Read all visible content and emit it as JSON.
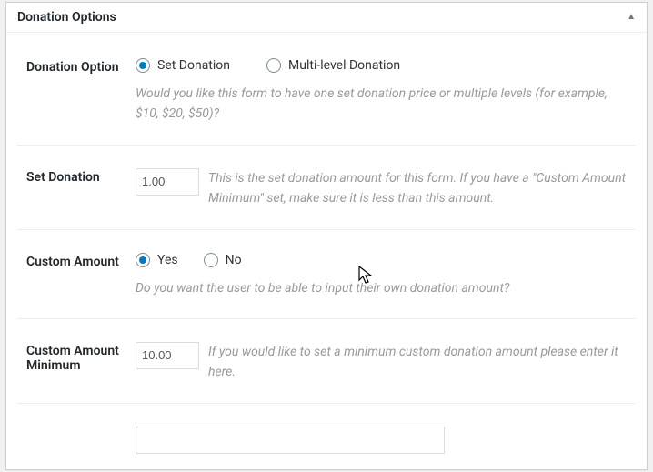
{
  "panel": {
    "title": "Donation Options"
  },
  "donation_option": {
    "label": "Donation Option",
    "choices": {
      "set": "Set Donation",
      "multi": "Multi-level Donation"
    },
    "help": "Would you like this form to have one set donation price or multiple levels (for example, $10, $20, $50)?"
  },
  "set_donation": {
    "label": "Set Donation",
    "value": "1.00",
    "help_a": "This is the set donation amount for this form. If you have a \"Custom Amount Minimum\" set, make sure it is less than this amount."
  },
  "custom_amount": {
    "label": "Custom Amount",
    "choices": {
      "yes": "Yes",
      "no": "No"
    },
    "help": "Do you want the user to be able to input their own donation amount?"
  },
  "custom_min": {
    "label": "Custom Amount Minimum",
    "value": "10.00",
    "help": "If you would like to set a minimum custom donation amount please enter it here."
  }
}
